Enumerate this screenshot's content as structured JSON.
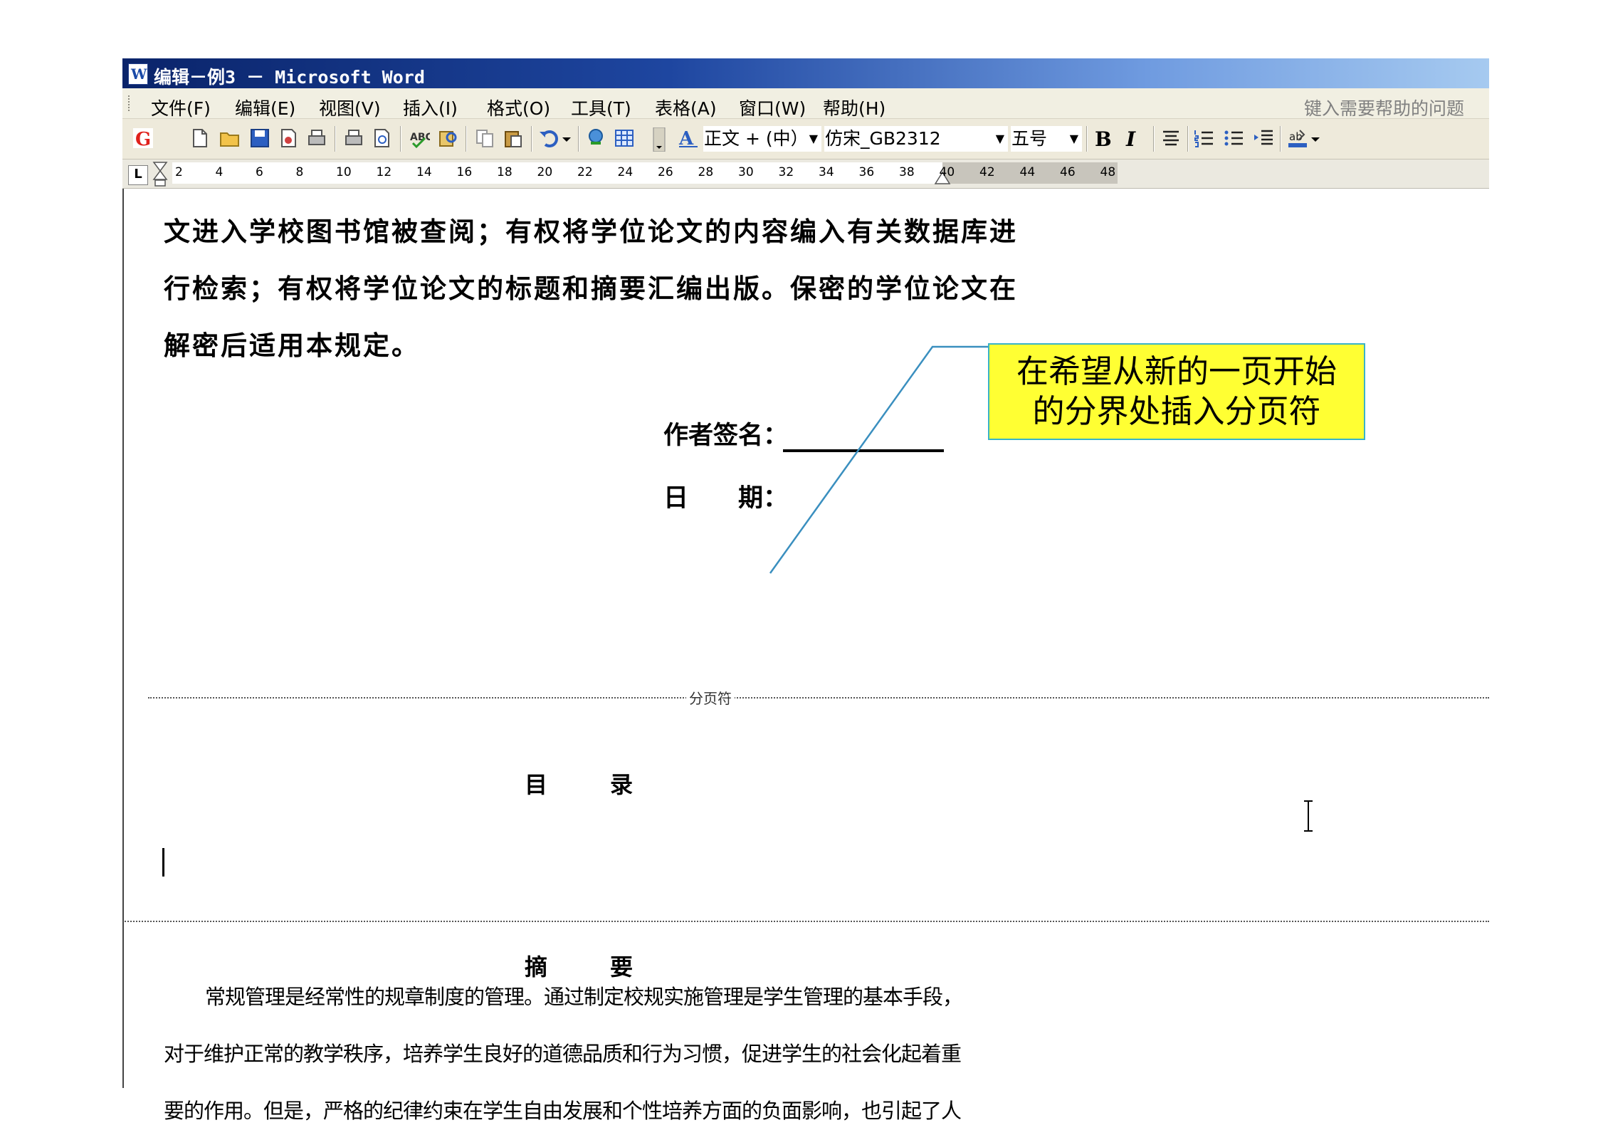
{
  "window": {
    "title": "编辑－例3 － Microsoft Word"
  },
  "menu": {
    "items": [
      "文件(F)",
      "编辑(E)",
      "视图(V)",
      "插入(I)",
      "格式(O)",
      "工具(T)",
      "表格(A)",
      "窗口(W)",
      "帮助(H)"
    ],
    "help_placeholder": "键入需要帮助的问题"
  },
  "toolbar": {
    "style": "正文 + (中）",
    "font": "仿宋_GB2312",
    "size": "五号",
    "bold_label": "B",
    "italic_label": "I"
  },
  "ruler": {
    "ticks": [
      "2",
      "4",
      "6",
      "8",
      "10",
      "12",
      "14",
      "16",
      "18",
      "20",
      "22",
      "24",
      "26",
      "28",
      "30",
      "32",
      "34",
      "36",
      "38",
      "40",
      "42",
      "44",
      "46",
      "48"
    ]
  },
  "document": {
    "lines": [
      "文进入学校图书馆被查阅；有权将学位论文的内容编入有关数据库进",
      "行检索；有权将学位论文的标题和摘要汇编出版。保密的学位论文在",
      "解密后适用本规定。"
    ],
    "signature_label": "作者签名：",
    "date_label": "日　　期：",
    "page_break_label": "分页符",
    "toc_heading": "目　录",
    "abstract_heading": "摘　要",
    "paragraph": [
      "常规管理是经常性的规章制度的管理。通过制定校规实施管理是学生管理的基本手段，",
      "对于维护正常的教学秩序，培养学生良好的道德品质和行为习惯，促进学生的社会化起着重",
      "要的作用。但是，严格的纪律约束在学生自由发展和个性培养方面的负面影响，也引起了人"
    ]
  },
  "callout": {
    "line1": "在希望从新的一页开始",
    "line2": "的分界处插入分页符"
  },
  "colors": {
    "callout_bg": "#ffff33",
    "callout_border": "#3ab3c7",
    "titlebar": "#0a246a"
  }
}
